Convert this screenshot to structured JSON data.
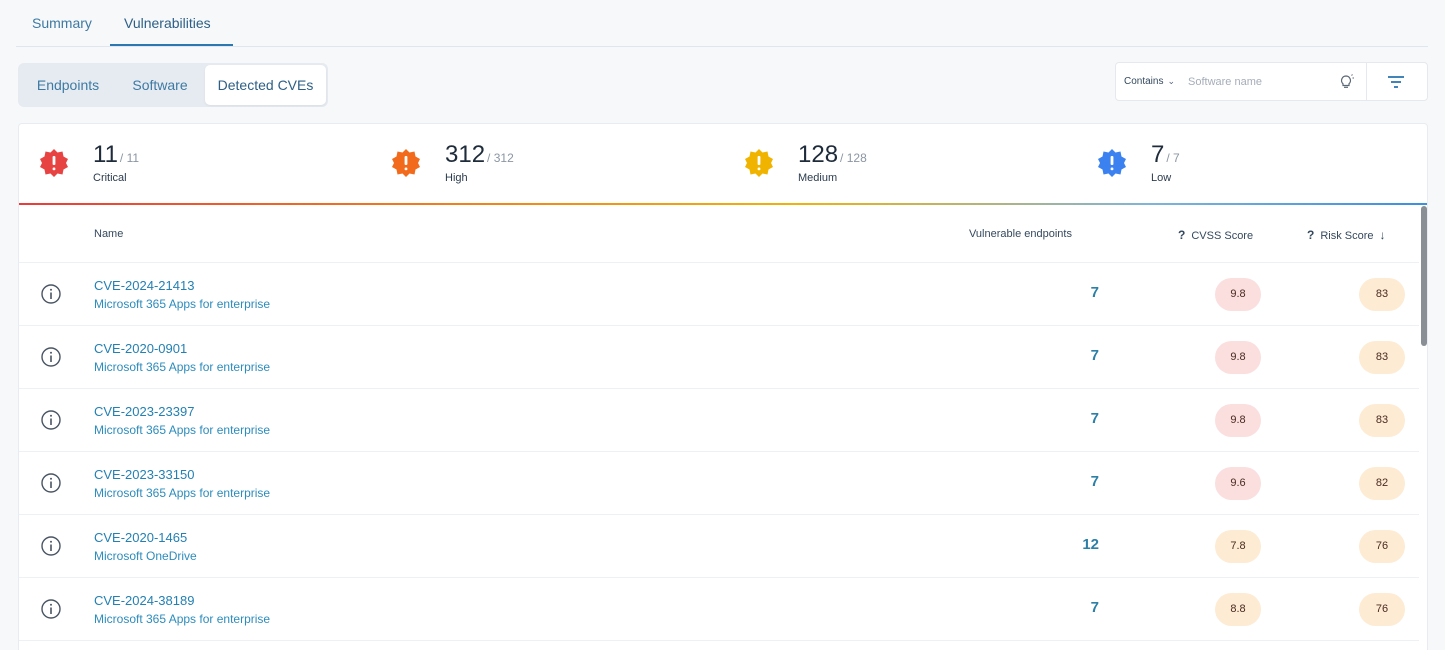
{
  "top_tabs": [
    {
      "label": "Summary"
    },
    {
      "label": "Vulnerabilities"
    }
  ],
  "segments": [
    {
      "label": "Endpoints"
    },
    {
      "label": "Software"
    },
    {
      "label": "Detected CVEs"
    }
  ],
  "search": {
    "mode": "Contains",
    "placeholder": "Software name"
  },
  "severity": [
    {
      "count": "11",
      "total": "/ 11",
      "label": "Critical",
      "color": "#e84343"
    },
    {
      "count": "312",
      "total": "/ 312",
      "label": "High",
      "color": "#f26a1b"
    },
    {
      "count": "128",
      "total": "/ 128",
      "label": "Medium",
      "color": "#f0b400"
    },
    {
      "count": "7",
      "total": "/ 7",
      "label": "Low",
      "color": "#3b82f0"
    }
  ],
  "table": {
    "headers": {
      "name": "Name",
      "vulnerable": "Vulnerable endpoints",
      "cvss": "CVSS Score",
      "risk": "Risk Score"
    },
    "rows": [
      {
        "cve": "CVE-2024-21413",
        "software": "Microsoft 365 Apps for enterprise",
        "endpoints": "7",
        "cvss": "9.8",
        "risk": "83",
        "cvss_color": "#fbdede",
        "risk_color": "#fdebd3"
      },
      {
        "cve": "CVE-2020-0901",
        "software": "Microsoft 365 Apps for enterprise",
        "endpoints": "7",
        "cvss": "9.8",
        "risk": "83",
        "cvss_color": "#fbdede",
        "risk_color": "#fdebd3"
      },
      {
        "cve": "CVE-2023-23397",
        "software": "Microsoft 365 Apps for enterprise",
        "endpoints": "7",
        "cvss": "9.8",
        "risk": "83",
        "cvss_color": "#fbdede",
        "risk_color": "#fdebd3"
      },
      {
        "cve": "CVE-2023-33150",
        "software": "Microsoft 365 Apps for enterprise",
        "endpoints": "7",
        "cvss": "9.6",
        "risk": "82",
        "cvss_color": "#fbdede",
        "risk_color": "#fdebd3"
      },
      {
        "cve": "CVE-2020-1465",
        "software": "Microsoft OneDrive",
        "endpoints": "12",
        "cvss": "7.8",
        "risk": "76",
        "cvss_color": "#fdebd3",
        "risk_color": "#fdebd3"
      },
      {
        "cve": "CVE-2024-38189",
        "software": "Microsoft 365 Apps for enterprise",
        "endpoints": "7",
        "cvss": "8.8",
        "risk": "76",
        "cvss_color": "#fdebd3",
        "risk_color": "#fdebd3"
      }
    ]
  }
}
